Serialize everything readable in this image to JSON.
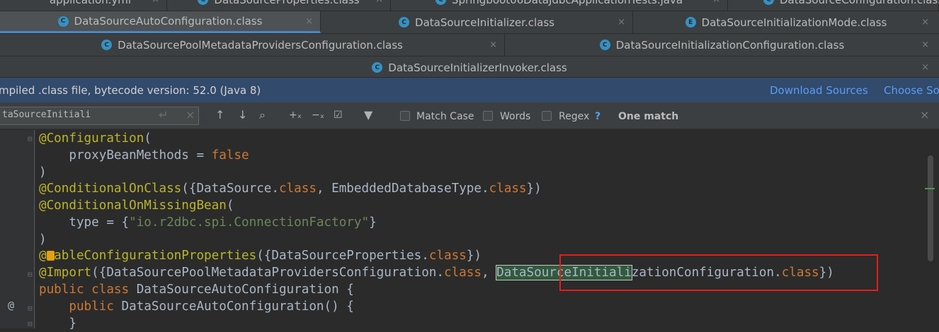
{
  "tabs_row0": [
    {
      "label": "application.yml",
      "close": "×"
    },
    {
      "label": "DataSourceProperties.class",
      "close": "×"
    },
    {
      "label": "Springboot06DataJdbcApplicationTests.java",
      "close": "×"
    },
    {
      "label": "DataSourceConfiguration.class",
      "close": ""
    }
  ],
  "tabs_row1": [
    {
      "label": "DataSourceAutoConfiguration.class",
      "icon": "C",
      "close": "×",
      "active": true
    },
    {
      "label": "DataSourceInitializer.class",
      "icon": "C",
      "close": "×"
    },
    {
      "label": "DataSourceInitializationMode.class",
      "icon": "E",
      "close": "×"
    }
  ],
  "tabs_row2": [
    {
      "label": "DataSourcePoolMetadataProvidersConfiguration.class",
      "icon": "C",
      "close": "×"
    },
    {
      "label": "DataSourceInitializationConfiguration.class",
      "icon": "C",
      "close": "×"
    }
  ],
  "tabs_row3": [
    {
      "label": "DataSourceInitializerInvoker.class",
      "icon": "C",
      "close": "×"
    }
  ],
  "notification": {
    "text": "mpiled .class file, bytecode version: 52.0 (Java 8)",
    "download_sources": "Download Sources",
    "choose_sources": "Choose So"
  },
  "find": {
    "query": "taSourceInitiali",
    "match_case": "Match Case",
    "words": "Words",
    "regex": "Regex",
    "help": "?",
    "result": "One match",
    "close": "×"
  },
  "code": {
    "l1_ann": "@Configuration",
    "l1_rest": "(",
    "l2_a": "    proxyBeanMethods = ",
    "l2_kw": "false",
    "l3": ")",
    "l4_ann": "@ConditionalOnClass",
    "l4_a": "({DataSource.",
    "l4_kw1": "class",
    "l4_b": ", EmbeddedDatabaseType.",
    "l4_kw2": "class",
    "l4_c": "})",
    "l5_ann": "@ConditionalOnMissingBean",
    "l5_rest": "(",
    "l6_a": "    type = {",
    "l6_str": "\"io.r2dbc.spi.ConnectionFactory\"",
    "l6_b": "}",
    "l7": ")",
    "l8_ann1": "@",
    "l8_ann2": "nableConfigurationProperties",
    "l8_a": "({DataSourceProperties.",
    "l8_kw": "class",
    "l8_b": "})",
    "l9_ann": "@Import",
    "l9_a": "({DataSourcePoolMetadataProvidersConfiguration.",
    "l9_kw1": "class",
    "l9_b": ", ",
    "l9_hl": "DataSourceInitiali",
    "l9_c": "zationConfiguration.",
    "l9_kw2": "class",
    "l9_d": "})",
    "l10_kw": "public class",
    "l10_rest": " DataSourceAutoConfiguration {",
    "l11_kw": "    public",
    "l11_rest": " DataSourceAutoConfiguration() {",
    "l12": "    }"
  },
  "gutter_at": "@"
}
